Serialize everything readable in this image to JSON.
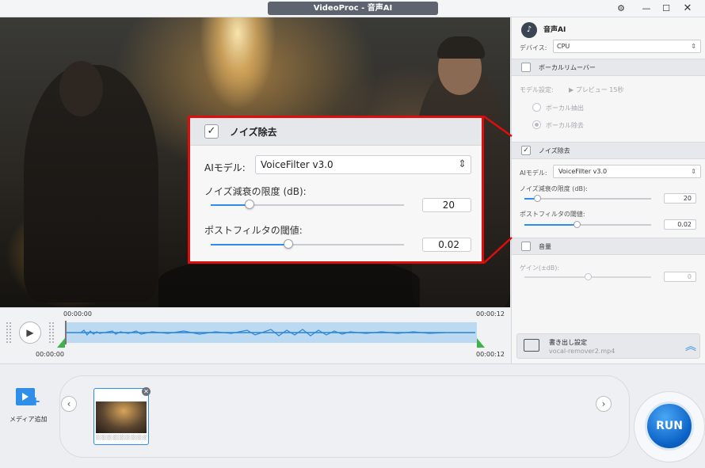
{
  "window": {
    "title": "VideoProc - 音声AI"
  },
  "callout": {
    "section_title": "ノイズ除去",
    "model_label": "AIモデル:",
    "model_value": "VoiceFilter v3.0",
    "noise_label": "ノイズ減衰の限度 (dB):",
    "noise_value": "20",
    "noise_level": 0.1,
    "post_label": "ポストフィルタの閾値:",
    "post_value": "0.02",
    "post_level": 0.4
  },
  "panel": {
    "title": "音声AI",
    "device_label": "デバイス:",
    "device_value": "CPU",
    "vocal_section": "ボーカルリムーバー",
    "model_setting_label": "モデル設定:",
    "preview_label": "プレビュー 15秒",
    "vocal_extract": "ボーカル抽出",
    "vocal_remove": "ボーカル除去",
    "noise_section": "ノイズ除去",
    "ai_model_label": "AIモデル:",
    "ai_model_value": "VoiceFilter v3.0",
    "noise_label": "ノイズ減衰の限度 (dB):",
    "noise_value": "20",
    "post_label": "ポストフィルタの閾値:",
    "post_value": "0.02",
    "volume_section": "音量",
    "gain_label": "ゲイン(±dB):",
    "gain_value": "0",
    "export_label": "書き出し設定",
    "export_file": "vocal-remover2.mp4"
  },
  "timeline": {
    "start_top": "00:00:00",
    "end_top": "00:00:12",
    "start_bottom": "00:00:00",
    "end_bottom": "00:00:12"
  },
  "media": {
    "add_label": "メディア追加",
    "clip_name": "░░░░░░░░░░░░░░.n"
  },
  "run_label": "RUN",
  "colors": {
    "accent": "#2d8cf0",
    "callout_border": "#e10c0c",
    "run": "#0d64c8"
  }
}
